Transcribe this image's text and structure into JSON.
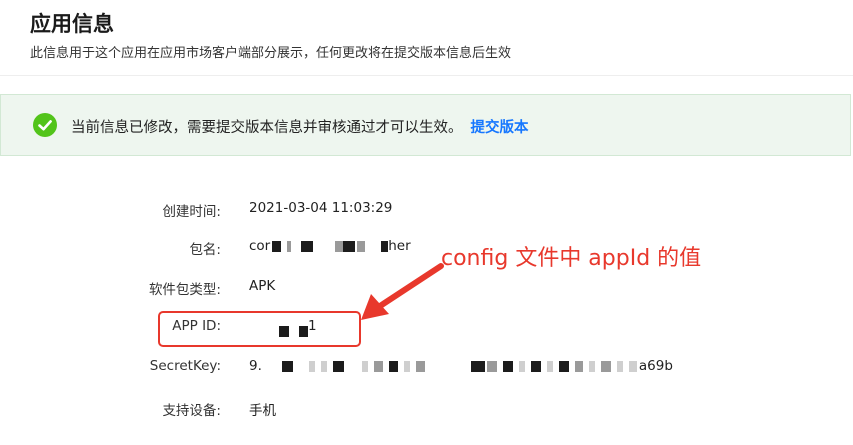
{
  "page": {
    "title": "应用信息",
    "subtitle": "此信息用于这个应用在应用市场客户端部分展示，任何更改将在提交版本信息后生效"
  },
  "notice": {
    "text": "当前信息已修改，需要提交版本信息并审核通过才可以生效。",
    "link": "提交版本",
    "icon": "check-circle-icon",
    "color": "#52c41a"
  },
  "fields": {
    "created": {
      "label": "创建时间:",
      "value": "2021-03-04 11:03:29"
    },
    "package": {
      "label": "包名:",
      "value_prefix": "cor",
      "value_suffix": "her"
    },
    "type": {
      "label": "软件包类型:",
      "value": "APK"
    },
    "appid": {
      "label": "APP ID:",
      "value_suffix": "1"
    },
    "secret": {
      "label": "SecretKey:",
      "value_prefix": "9.",
      "value_suffix": "a69b"
    },
    "device": {
      "label": "支持设备:",
      "value": "手机"
    }
  },
  "annotation": {
    "text": "config 文件中 appId 的值",
    "color": "#e8382c"
  }
}
